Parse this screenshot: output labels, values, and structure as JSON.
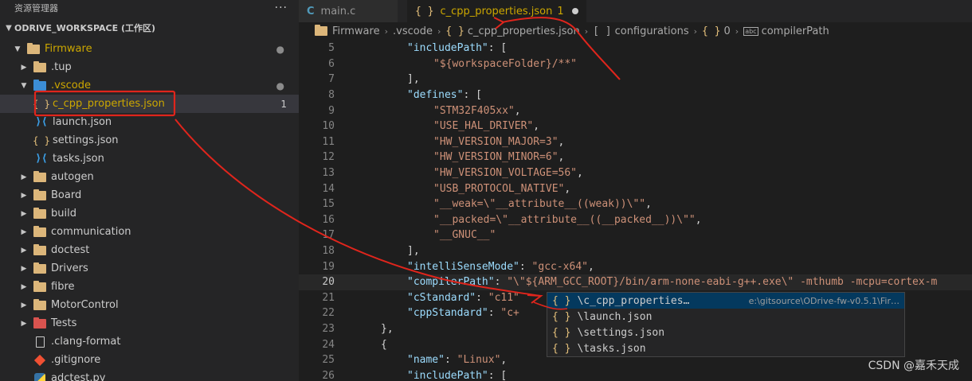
{
  "sidebar": {
    "title": "资源管理器",
    "more": "···",
    "workspace": "ODRIVE_WORKSPACE (工作区)",
    "items": [
      {
        "label": "Firmware",
        "depth": 1,
        "type": "folder",
        "expanded": true,
        "badge": "●",
        "warn": true
      },
      {
        "label": ".tup",
        "depth": 2,
        "type": "folder",
        "expanded": false
      },
      {
        "label": ".vscode",
        "depth": 2,
        "type": "folder-blue",
        "expanded": true,
        "badge": "●",
        "warn": true
      },
      {
        "label": "c_cpp_properties.json",
        "depth": 3,
        "type": "braces",
        "count": "1",
        "warn": true,
        "selected": true
      },
      {
        "label": "launch.json",
        "depth": 3,
        "type": "vscode"
      },
      {
        "label": "settings.json",
        "depth": 3,
        "type": "braces"
      },
      {
        "label": "tasks.json",
        "depth": 3,
        "type": "vscode"
      },
      {
        "label": "autogen",
        "depth": 2,
        "type": "folder",
        "expanded": false
      },
      {
        "label": "Board",
        "depth": 2,
        "type": "folder",
        "expanded": false
      },
      {
        "label": "build",
        "depth": 2,
        "type": "folder",
        "expanded": false
      },
      {
        "label": "communication",
        "depth": 2,
        "type": "folder",
        "expanded": false
      },
      {
        "label": "doctest",
        "depth": 2,
        "type": "folder",
        "expanded": false
      },
      {
        "label": "Drivers",
        "depth": 2,
        "type": "folder",
        "expanded": false
      },
      {
        "label": "fibre",
        "depth": 2,
        "type": "folder",
        "expanded": false
      },
      {
        "label": "MotorControl",
        "depth": 2,
        "type": "folder",
        "expanded": false
      },
      {
        "label": "Tests",
        "depth": 2,
        "type": "folder-red",
        "expanded": false
      },
      {
        "label": ".clang-format",
        "depth": 2,
        "type": "file"
      },
      {
        "label": ".gitignore",
        "depth": 2,
        "type": "git"
      },
      {
        "label": "adctest.py",
        "depth": 2,
        "type": "python"
      }
    ]
  },
  "tabs": [
    {
      "label": "main.c",
      "icon": "C",
      "active": false
    },
    {
      "label": "c_cpp_properties.json",
      "icon": "{ }",
      "active": true,
      "count": "1"
    }
  ],
  "breadcrumb": [
    "Firmware",
    ".vscode",
    "c_cpp_properties.json",
    "configurations",
    "0",
    "compilerPath"
  ],
  "breadcrumb_icons": {
    "braces": "{ }",
    "bracket": "[ ]",
    "abc": "abc"
  },
  "editor": {
    "current_line": "20",
    "lines": [
      {
        "n": "5",
        "indent": 2,
        "parts": [
          [
            "k",
            "\"includePath\""
          ],
          [
            "p",
            ": ["
          ]
        ]
      },
      {
        "n": "6",
        "indent": 3,
        "parts": [
          [
            "s",
            "\"${workspaceFolder}/**\""
          ]
        ]
      },
      {
        "n": "7",
        "indent": 2,
        "parts": [
          [
            "p",
            "],"
          ]
        ]
      },
      {
        "n": "8",
        "indent": 2,
        "parts": [
          [
            "k",
            "\"defines\""
          ],
          [
            "p",
            ": ["
          ]
        ]
      },
      {
        "n": "9",
        "indent": 3,
        "parts": [
          [
            "s",
            "\"STM32F405xx\""
          ],
          [
            "p",
            ","
          ]
        ]
      },
      {
        "n": "10",
        "indent": 3,
        "parts": [
          [
            "s",
            "\"USE_HAL_DRIVER\""
          ],
          [
            "p",
            ","
          ]
        ]
      },
      {
        "n": "11",
        "indent": 3,
        "parts": [
          [
            "s",
            "\"HW_VERSION_MAJOR=3\""
          ],
          [
            "p",
            ","
          ]
        ]
      },
      {
        "n": "12",
        "indent": 3,
        "parts": [
          [
            "s",
            "\"HW_VERSION_MINOR=6\""
          ],
          [
            "p",
            ","
          ]
        ]
      },
      {
        "n": "13",
        "indent": 3,
        "parts": [
          [
            "s",
            "\"HW_VERSION_VOLTAGE=56\""
          ],
          [
            "p",
            ","
          ]
        ]
      },
      {
        "n": "14",
        "indent": 3,
        "parts": [
          [
            "s",
            "\"USB_PROTOCOL_NATIVE\""
          ],
          [
            "p",
            ","
          ]
        ]
      },
      {
        "n": "15",
        "indent": 3,
        "parts": [
          [
            "s",
            "\"__weak=\\\"__attribute__((weak))\\\"\""
          ],
          [
            "p",
            ","
          ]
        ]
      },
      {
        "n": "16",
        "indent": 3,
        "parts": [
          [
            "s",
            "\"__packed=\\\"__attribute__((__packed__))\\\"\""
          ],
          [
            "p",
            ","
          ]
        ]
      },
      {
        "n": "17",
        "indent": 3,
        "parts": [
          [
            "s",
            "\"__GNUC__\""
          ]
        ]
      },
      {
        "n": "18",
        "indent": 2,
        "parts": [
          [
            "p",
            "],"
          ]
        ]
      },
      {
        "n": "19",
        "indent": 2,
        "parts": [
          [
            "k",
            "\"intelliSenseMode\""
          ],
          [
            "p",
            ": "
          ],
          [
            "s",
            "\"gcc-x64\""
          ],
          [
            "p",
            ","
          ]
        ]
      },
      {
        "n": "20",
        "indent": 2,
        "parts": [
          [
            "k",
            "\"compilerPath\""
          ],
          [
            "p",
            ": "
          ],
          [
            "s",
            "\"\\\"${ARM_GCC_ROOT}/bin/arm-none-eabi-g++.exe\\\" -mthumb -mcpu=cortex-m"
          ]
        ]
      },
      {
        "n": "21",
        "indent": 2,
        "parts": [
          [
            "k",
            "\"cStandard\""
          ],
          [
            "p",
            ": "
          ],
          [
            "s",
            "\"c11\""
          ]
        ]
      },
      {
        "n": "22",
        "indent": 2,
        "parts": [
          [
            "k",
            "\"cppStandard\""
          ],
          [
            "p",
            ": "
          ],
          [
            "s",
            "\"c+"
          ]
        ]
      },
      {
        "n": "23",
        "indent": 1,
        "parts": [
          [
            "p",
            "},"
          ]
        ]
      },
      {
        "n": "24",
        "indent": 1,
        "parts": [
          [
            "p",
            "{"
          ]
        ]
      },
      {
        "n": "25",
        "indent": 2,
        "parts": [
          [
            "k",
            "\"name\""
          ],
          [
            "p",
            ": "
          ],
          [
            "s",
            "\"Linux\""
          ],
          [
            "p",
            ","
          ]
        ]
      },
      {
        "n": "26",
        "indent": 2,
        "parts": [
          [
            "k",
            "\"includePath\""
          ],
          [
            "p",
            ": ["
          ]
        ]
      }
    ]
  },
  "suggestions": [
    {
      "icon": "{ }",
      "label": "\\c_cpp_properties…",
      "detail": "e:\\gitsource\\ODrive-fw-v0.5.1\\Fir…",
      "selected": true
    },
    {
      "icon": "{ }",
      "label": "\\launch.json",
      "detail": ""
    },
    {
      "icon": "{ }",
      "label": "\\settings.json",
      "detail": ""
    },
    {
      "icon": "{ }",
      "label": "\\tasks.json",
      "detail": ""
    }
  ],
  "watermark": "CSDN @嘉禾天成",
  "colors": {
    "annotation": "#e0251c",
    "warning": "#cca700",
    "accent": "#e5c07b"
  }
}
